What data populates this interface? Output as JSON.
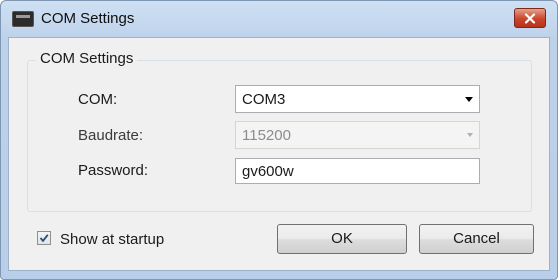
{
  "window": {
    "title": "COM Settings",
    "close_icon": "close-icon"
  },
  "group": {
    "legend": "COM Settings"
  },
  "com": {
    "label": "COM:",
    "value": "COM3"
  },
  "baudrate": {
    "label": "Baudrate:",
    "value": "115200",
    "enabled": false
  },
  "password": {
    "label": "Password:",
    "value": "gv600w"
  },
  "startup": {
    "label": "Show at startup",
    "checked": true
  },
  "buttons": {
    "ok": "OK",
    "cancel": "Cancel"
  },
  "colors": {
    "titlebar": "#bcd1ea",
    "close_button": "#c8452c",
    "client_bg": "#f0f0f0"
  }
}
